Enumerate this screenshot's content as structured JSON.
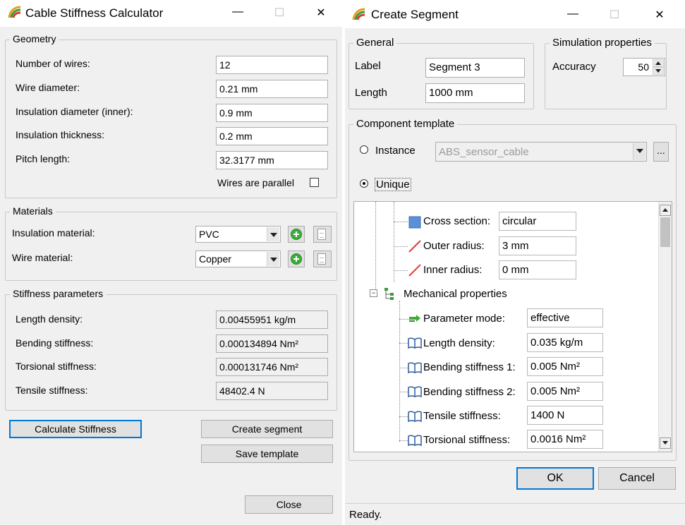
{
  "calc": {
    "title": "Cable Stiffness Calculator",
    "geometry": {
      "legend": "Geometry",
      "num_wires_label": "Number of wires:",
      "num_wires_value": "12",
      "wire_diameter_label": "Wire diameter:",
      "wire_diameter_value": "0.21 mm",
      "insulation_diameter_label": "Insulation diameter (inner):",
      "insulation_diameter_value": "0.9 mm",
      "insulation_thickness_label": "Insulation thickness:",
      "insulation_thickness_value": "0.2 mm",
      "pitch_length_label": "Pitch length:",
      "pitch_length_value": "32.3177 mm",
      "parallel_label": "Wires are parallel",
      "parallel_checked": false
    },
    "materials": {
      "legend": "Materials",
      "insulation_label": "Insulation material:",
      "insulation_value": "PVC",
      "wire_label": "Wire material:",
      "wire_value": "Copper"
    },
    "stiffness": {
      "legend": "Stiffness parameters",
      "length_density_label": "Length density:",
      "length_density_value": "0.00455951 kg/m",
      "bending_label": "Bending stiffness:",
      "bending_value": "0.000134894 Nm²",
      "torsional_label": "Torsional stiffness:",
      "torsional_value": "0.000131746 Nm²",
      "tensile_label": "Tensile stiffness:",
      "tensile_value": "48402.4 N"
    },
    "buttons": {
      "calculate": "Calculate Stiffness",
      "create_segment": "Create segment",
      "save_template": "Save template",
      "close": "Close"
    }
  },
  "segment": {
    "title": "Create Segment",
    "general": {
      "legend": "General",
      "label_label": "Label",
      "label_value": "Segment 3",
      "length_label": "Length",
      "length_value": "1000 mm"
    },
    "simulation": {
      "legend": "Simulation properties",
      "accuracy_label": "Accuracy",
      "accuracy_value": "50"
    },
    "template": {
      "legend": "Component template",
      "instance_label": "Instance",
      "instance_value": "ABS_sensor_cable",
      "browse_label": "...",
      "unique_label": "Unique",
      "mode": "unique"
    },
    "tree": {
      "cross_section_label": "Cross section:",
      "cross_section_value": "circular",
      "outer_radius_label": "Outer radius:",
      "outer_radius_value": "3 mm",
      "inner_radius_label": "Inner radius:",
      "inner_radius_value": "0 mm",
      "mechanical_label": "Mechanical properties",
      "parameter_mode_label": "Parameter mode:",
      "parameter_mode_value": "effective",
      "length_density_label": "Length density:",
      "length_density_value": "0.035 kg/m",
      "bending1_label": "Bending stiffness 1:",
      "bending1_value": "0.005 Nm²",
      "bending2_label": "Bending stiffness 2:",
      "bending2_value": "0.005 Nm²",
      "tensile_label": "Tensile stiffness:",
      "tensile_value": "1400 N",
      "torsional_label": "Torsional stiffness:",
      "torsional_value": "0.0016 Nm²"
    },
    "buttons": {
      "ok": "OK",
      "cancel": "Cancel"
    },
    "status": "Ready."
  },
  "colors": {
    "window_bg": "#f0f0f0",
    "accent_blue": "#0078d7",
    "add_green": "#3cab3c",
    "line_red": "#e23b3b",
    "cross_section_blue": "#5b8fd6"
  },
  "icons": {
    "app": "cable-logo-icon",
    "minimize": "minimize-icon",
    "maximize": "maximize-icon",
    "close": "close-icon",
    "add": "add-material-icon",
    "document": "document-icon",
    "book": "book-icon",
    "mode": "mode-arrows-icon",
    "tree_toggle": "collapse-icon"
  }
}
